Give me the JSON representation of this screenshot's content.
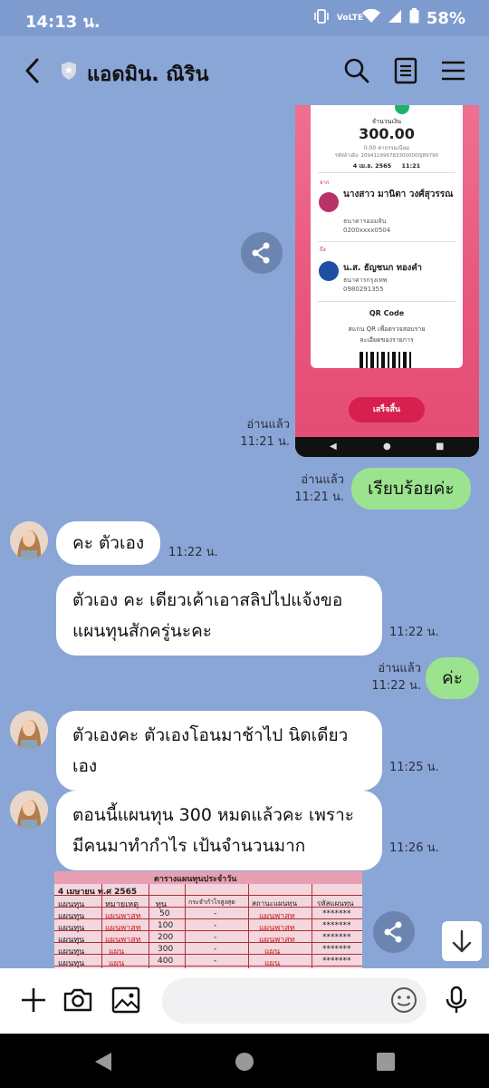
{
  "status_bar": {
    "time": "14:13 น.",
    "network": "VoLTE",
    "battery": "58%"
  },
  "header": {
    "title": "แอดมิน. ณิริน"
  },
  "receipt": {
    "amount_label": "จำนวนเงิน",
    "amount": "300.00",
    "fee": "0.00 ค่าธรรมเนียม",
    "ref": "รหัสอ้างอิง: 2094119967833000000J89790",
    "date": "4 เม.ย. 2565",
    "time": "11:21",
    "from_label": "จาก",
    "from_name": "นางสาว มานิตา วงศ์สุวรรณ",
    "from_bank": "ธนาคารออมสิน",
    "from_account": "0200xxxx0504",
    "to_label": "ถึง",
    "to_name": "น.ส. ธัญชนก ทองคำ",
    "to_bank": "ธนาคารกรุงเทพ",
    "to_account": "0980291355",
    "qr_title": "QR Code",
    "qr_desc_1": "สแกน QR เพื่อตรวจสอบราย",
    "qr_desc_2": "ละเอียดของรายการ",
    "finish_button": "เสร็จสิ้น"
  },
  "messages": [
    {
      "side": "out",
      "read": "อ่านแล้ว",
      "time": "11:21 น.",
      "kind": "image"
    },
    {
      "side": "out",
      "read": "อ่านแล้ว",
      "time": "11:21 น.",
      "text": "เรียบร้อยค่ะ"
    },
    {
      "side": "in",
      "time": "11:22 น.",
      "text": "คะ ตัวเอง"
    },
    {
      "side": "in",
      "time": "11:22 น.",
      "line1": "ตัวเอง คะ เดียวเค้าเอาสลิปไปแจ้งขอ",
      "line2": "แผนทุนสักครู่นะคะ"
    },
    {
      "side": "out",
      "read": "อ่านแล้ว",
      "time": "11:22 น.",
      "text": "ค่ะ"
    },
    {
      "side": "in",
      "time": "11:25 น.",
      "line1": "ตัวเองคะ ตัวเองโอนมาช้าไป นิดเดียว",
      "line2": "เอง"
    },
    {
      "side": "in",
      "time": "11:26 น.",
      "line1": "ตอนนี้แผนทุน 300 หมดแล้วคะ เพราะ",
      "line2": "มีคนมาทำกำไร เป้นจำนวนมาก"
    }
  ],
  "table_image": {
    "title": "ตารางแผนทุนประจำวัน",
    "date": "4 เมษายน พ.ศ 2565",
    "headers": [
      "แผนทุน",
      "หมายเหตุ",
      "ทุน",
      "กระจำกำไรสูงสุด",
      "สถานะแผนทุน",
      "รหัสแผนทุน"
    ],
    "rows": [
      [
        "แผนทุน",
        "แผนพาสท",
        "50",
        "-",
        "แผนพาสท",
        "*******"
      ],
      [
        "แผนทุน",
        "แผนพาสท",
        "100",
        "-",
        "แผนพาสท",
        "*******"
      ],
      [
        "แผนทุน",
        "แผนพาสท",
        "200",
        "-",
        "แผนพาสท",
        "*******"
      ],
      [
        "แผนทุน",
        "แผน",
        "300",
        "-",
        "แผน",
        "*******"
      ],
      [
        "แผนทุน",
        "แผน",
        "400",
        "-",
        "แผน",
        "*******"
      ]
    ]
  },
  "input": {
    "placeholder": ""
  }
}
